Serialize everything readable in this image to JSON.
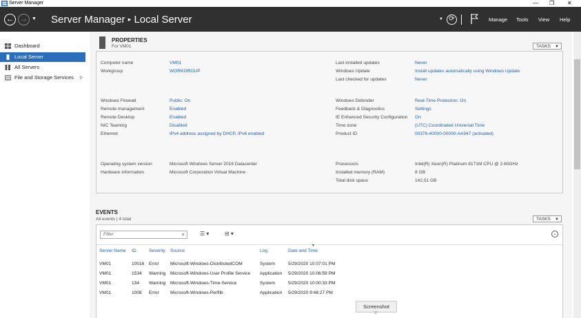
{
  "window": {
    "title": "Server Manager",
    "controls": [
      "—",
      "❐",
      "✕"
    ]
  },
  "header": {
    "breadcrumb_root": "Server Manager",
    "breadcrumb_sep": "▸",
    "breadcrumb_current": "Local Server",
    "menu": {
      "manage": "Manage",
      "tools": "Tools",
      "view": "View",
      "help": "Help"
    }
  },
  "sidebar": {
    "items": [
      {
        "label": "Dashboard",
        "icon": "dashboard-icon"
      },
      {
        "label": "Local Server",
        "icon": "server-icon"
      },
      {
        "label": "All Servers",
        "icon": "servers-icon"
      },
      {
        "label": "File and Storage Services",
        "icon": "storage-icon",
        "chevron": "▷"
      }
    ]
  },
  "properties": {
    "title": "PROPERTIES",
    "subtitle": "For VM01",
    "tasks": "TASKS",
    "left": [
      {
        "label": "Computer name",
        "value": "VM01"
      },
      {
        "label": "Workgroup",
        "value": "WORKGROUP"
      },
      {
        "label": "Windows Firewall",
        "value": "Public: On"
      },
      {
        "label": "Remote management",
        "value": "Enabled"
      },
      {
        "label": "Remote Desktop",
        "value": "Enabled"
      },
      {
        "label": "NIC Teaming",
        "value": "Disabled"
      },
      {
        "label": "Ethernet",
        "value": "IPv4 address assigned by DHCP, IPv6 enabled"
      },
      {
        "label": "Operating system version",
        "value": "Microsoft Windows Server 2016 Datacenter"
      },
      {
        "label": "Hardware information",
        "value": "Microsoft Corporation Virtual Machine"
      }
    ],
    "right": [
      {
        "label": "Last installed updates",
        "value": "Never"
      },
      {
        "label": "Windows Update",
        "value": "Install updates automatically using Windows Update"
      },
      {
        "label": "Last checked for updates",
        "value": "Never"
      },
      {
        "label": "Windows Defender",
        "value": "Real-Time Protection: On"
      },
      {
        "label": "Feedback & Diagnostics",
        "value": "Settings"
      },
      {
        "label": "IE Enhanced Security Configuration",
        "value": "On"
      },
      {
        "label": "Time zone",
        "value": "(UTC) Coordinated Universal Time"
      },
      {
        "label": "Product ID",
        "value": "00376-40000-00000-AA947 (activated)"
      },
      {
        "label": "Processors",
        "value": "Intel(R) Xeon(R) Platinum 8171M CPU @ 2.60GHz"
      },
      {
        "label": "Installed memory (RAM)",
        "value": "8 GB"
      },
      {
        "label": "Total disk space",
        "value": "142,51 GB"
      }
    ]
  },
  "events": {
    "title": "EVENTS",
    "subtitle": "All events | 4 total",
    "tasks": "TASKS",
    "filter_placeholder": "Filter",
    "columns": [
      "Server Name",
      "ID",
      "Severity",
      "Source",
      "Log",
      "Date and Time"
    ],
    "rows": [
      [
        "VM01",
        "10016",
        "Error",
        "Microsoft-Windows-DistributedCOM",
        "System",
        "5/29/2020 10:07:01 PM"
      ],
      [
        "VM01",
        "1534",
        "Warning",
        "Microsoft-Windows-User Profile Service",
        "Application",
        "5/29/2020 10:06:59 PM"
      ],
      [
        "VM01",
        "134",
        "Warning",
        "Microsoft-Windows-Time-Service",
        "System",
        "5/29/2020 10:00:33 PM"
      ],
      [
        "VM01",
        "1008",
        "Error",
        "Microsoft-Windows-Perflib",
        "Application",
        "5/29/2020 9:46:27 PM"
      ]
    ]
  },
  "tooltip": {
    "text": "Screenshot"
  },
  "colors": {
    "header_bg": "#303030",
    "accent": "#2a6ebb",
    "link": "#1a5fb4"
  }
}
